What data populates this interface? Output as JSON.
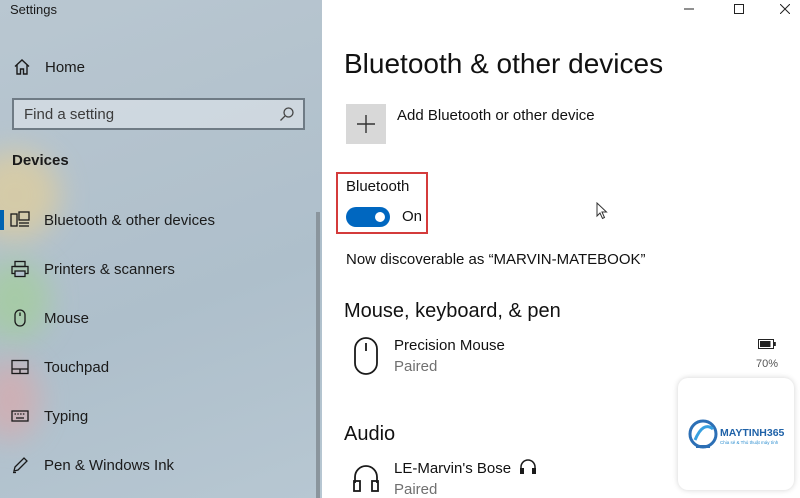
{
  "window": {
    "title": "Settings"
  },
  "sidebar": {
    "home_label": "Home",
    "search_placeholder": "Find a setting",
    "section_title": "Devices",
    "items": [
      {
        "label": "Bluetooth & other devices",
        "icon": "bluetooth-devices-icon",
        "active": true
      },
      {
        "label": "Printers & scanners",
        "icon": "printer-icon"
      },
      {
        "label": "Mouse",
        "icon": "mouse-icon"
      },
      {
        "label": "Touchpad",
        "icon": "touchpad-icon"
      },
      {
        "label": "Typing",
        "icon": "keyboard-icon"
      },
      {
        "label": "Pen & Windows Ink",
        "icon": "pen-icon"
      }
    ]
  },
  "main": {
    "title": "Bluetooth & other devices",
    "add_device_label": "Add Bluetooth or other device",
    "bluetooth": {
      "label": "Bluetooth",
      "state_label": "On",
      "enabled": true
    },
    "discoverable_text": "Now discoverable as “MARVIN-MATEBOOK”",
    "groups": [
      {
        "title": "Mouse, keyboard, & pen",
        "devices": [
          {
            "name": "Precision Mouse",
            "status": "Paired",
            "battery": "70%"
          }
        ]
      },
      {
        "title": "Audio",
        "devices": [
          {
            "name": "LE-Marvin's Bose",
            "status": "Paired"
          }
        ]
      }
    ]
  },
  "watermark": {
    "brand": "MAYTINH365",
    "tagline": "Chia sẻ & Thủ thuật máy tính"
  },
  "colors": {
    "accent": "#0067c0",
    "highlight_box": "#d43b3b",
    "sidebar_bg": "#b3c2cd"
  }
}
